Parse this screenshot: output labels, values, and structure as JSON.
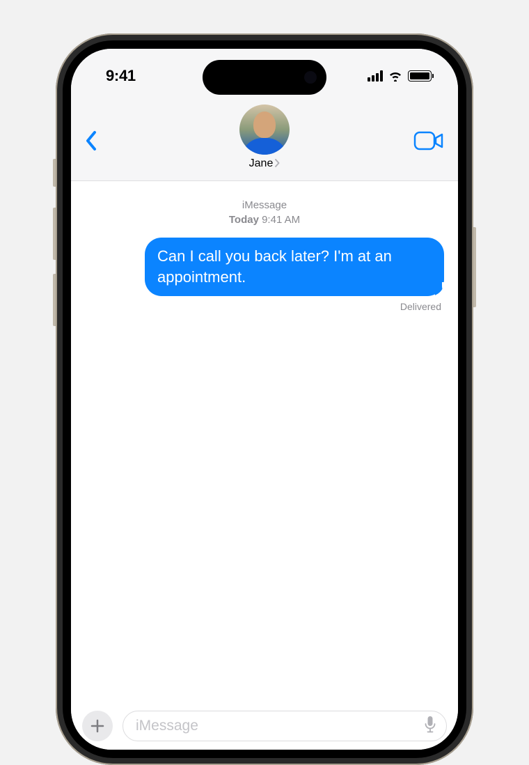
{
  "statusBar": {
    "time": "9:41"
  },
  "header": {
    "contactName": "Jane"
  },
  "conversation": {
    "service": "iMessage",
    "dayLabel": "Today",
    "timeLabel": "9:41 AM",
    "messages": [
      {
        "text": "Can I call you back later? I'm at an appointment.",
        "direction": "sent",
        "status": "Delivered"
      }
    ]
  },
  "input": {
    "placeholder": "iMessage"
  },
  "colors": {
    "accent": "#0b84ff",
    "bubbleSent": "#0b84ff",
    "headerBg": "#f6f6f7",
    "secondaryText": "#8a8a8f"
  }
}
